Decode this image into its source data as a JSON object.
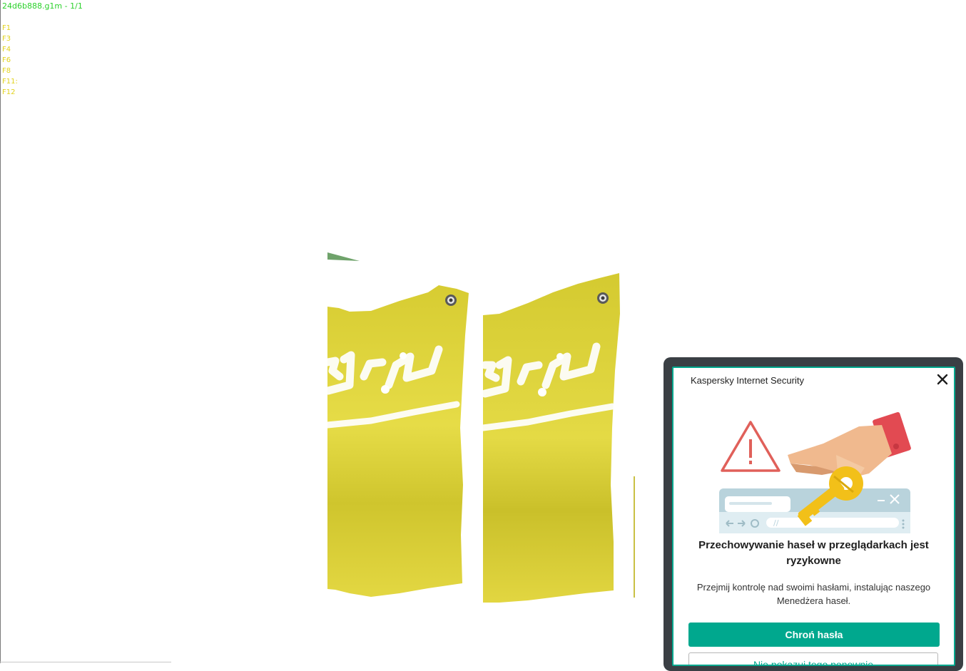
{
  "viewer": {
    "file_title": "24d6b888.g1m - 1/1",
    "function_keys": [
      "F1",
      "F3",
      "F4",
      "F6",
      "F8",
      "F11:",
      "F12"
    ]
  },
  "popup": {
    "app_name": "Kaspersky Internet Security",
    "headline": "Przechowywanie haseł w przeglądarkach jest ryzykowne",
    "description": "Przejmij kontrolę nad swoimi hasłami, instalując naszego Menedżera haseł.",
    "primary_button": "Chroń hasła",
    "secondary_button": "Nie pokazuj tego ponownie",
    "accent_color": "#00a88e",
    "icons": [
      "close-icon",
      "warning-icon",
      "key-icon",
      "browser-window-icon"
    ]
  },
  "scene": {
    "banner_color": "#d9cf3a",
    "pattern_color": "#ffffff"
  }
}
